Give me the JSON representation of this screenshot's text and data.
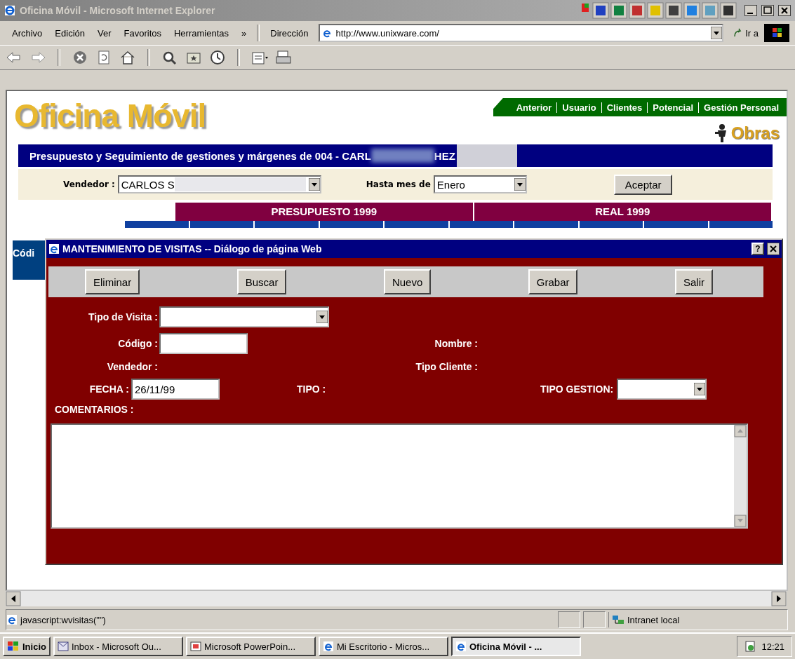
{
  "window": {
    "title": "Oficina Móvil - Microsoft Internet Explorer"
  },
  "menu": [
    "Archivo",
    "Edición",
    "Ver",
    "Favoritos",
    "Herramientas",
    "»"
  ],
  "address": {
    "label": "Dirección",
    "value": "http://www.unixware.com/",
    "go": "Ir a"
  },
  "page": {
    "logo": "Oficina Móvil",
    "nav": [
      "Anterior",
      "Usuario",
      "Clientes",
      "Potencial",
      "Gestión Personal"
    ],
    "section": "Obras",
    "header": {
      "text": "Presupuesto y Seguimiento de gestiones y márgenes de 004 - CARL",
      "tail": "HEZ"
    },
    "filter": {
      "vendor_label": "Vendedor :",
      "vendor_value": "CARLOS S",
      "month_label": "Hasta mes de",
      "month_value": "Enero",
      "button": "Aceptar"
    },
    "table_groups": [
      "PRESUPUESTO 1999",
      "REAL 1999"
    ],
    "side_cell": "Códi"
  },
  "dialog": {
    "title": "MANTENIMIENTO DE VISITAS -- Diálogo de página Web",
    "help": "?",
    "buttons": [
      "Eliminar",
      "Buscar",
      "Nuevo",
      "Grabar",
      "Salir"
    ],
    "tipo_visita": "Tipo de Visita :",
    "codigo": "Código :",
    "nombre": "Nombre :",
    "vendedor": "Vendedor :",
    "tipo_cliente": "Tipo Cliente :",
    "fecha_label": "FECHA :",
    "fecha_value": "26/11/99",
    "tipo": "TIPO :",
    "tipo_gestion": "TIPO GESTION:",
    "comentarios": "COMENTARIOS :"
  },
  "status": {
    "text": "javascript:wvisitas(\"\")",
    "zone": "Intranet local"
  },
  "taskbar": {
    "start": "Inicio",
    "tasks": [
      {
        "label": "Inbox - Microsoft Ou...",
        "selected": false
      },
      {
        "label": "Microsoft PowerPoin...",
        "selected": false
      },
      {
        "label": "Mi Escritorio - Micros...",
        "selected": false
      },
      {
        "label": "Oficina Móvil - ...",
        "selected": true
      }
    ],
    "clock": "12:21"
  }
}
